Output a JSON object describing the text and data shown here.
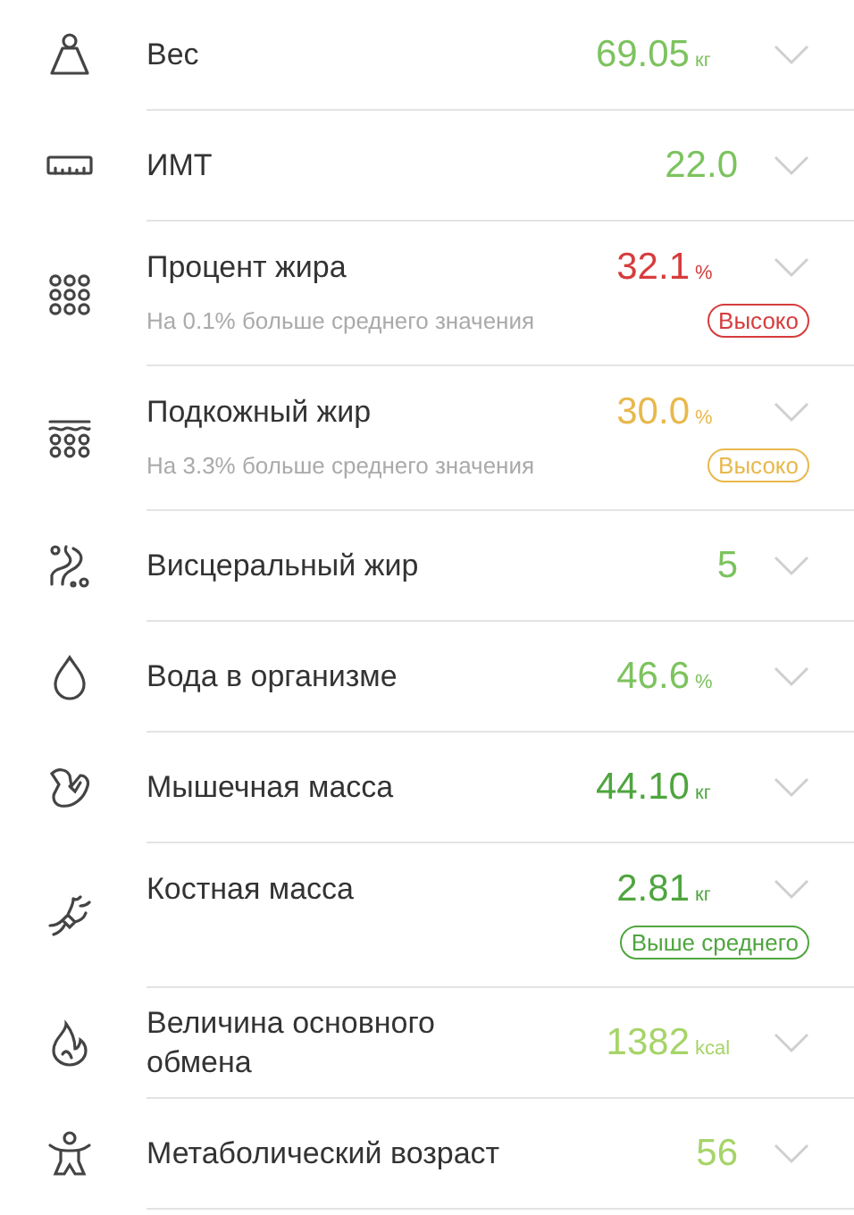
{
  "metrics": [
    {
      "kind": "weight",
      "label": "Вес",
      "value": "69.05",
      "unit": "кг",
      "color": "#7cc35e"
    },
    {
      "kind": "ruler",
      "label": "ИМТ",
      "value": "22.0",
      "color": "#7cc35e"
    },
    {
      "kind": "dots",
      "label": "Процент жира",
      "value": "32.1",
      "unit": "%",
      "color": "#d63c3c",
      "note": "На 0.1% больше среднего значения",
      "badge": "Высоко"
    },
    {
      "kind": "layers",
      "label": "Подкожный жир",
      "value": "30.0",
      "unit": "%",
      "color": "#e8b84c",
      "note": "На 3.3% больше среднего значения",
      "badge": "Высоко"
    },
    {
      "kind": "organs",
      "label": "Висцеральный жир",
      "value": "5",
      "color": "#7cc35e"
    },
    {
      "kind": "drop",
      "label": "Вода в организме",
      "value": "46.6",
      "unit": "%",
      "color": "#7cc35e"
    },
    {
      "kind": "muscle",
      "label": "Мышечная масса",
      "value": "44.10",
      "unit": "кг",
      "color": "#4fa53f"
    },
    {
      "kind": "bone",
      "label": "Костная масса",
      "value": "2.81",
      "unit": "кг",
      "color": "#4fa53f",
      "badge": "Выше среднего"
    },
    {
      "kind": "flame",
      "label": "Величина основного обмена",
      "value": "1382",
      "unit": "kcal",
      "color": "#a6d468"
    },
    {
      "kind": "person",
      "label": "Метаболический возраст",
      "value": "56",
      "color": "#a6d468"
    }
  ]
}
